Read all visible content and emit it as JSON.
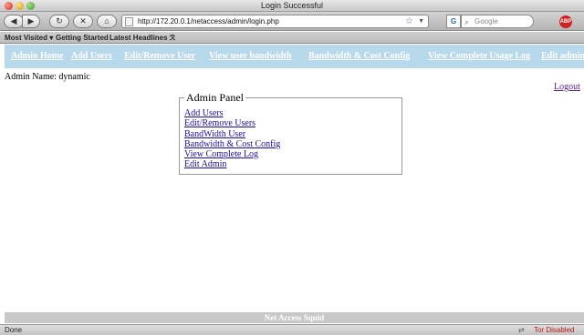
{
  "window": {
    "title": "Login Successful"
  },
  "toolbar": {
    "back_glyph": "◀",
    "forward_glyph": "▶",
    "reload_glyph": "↻",
    "stop_glyph": "✕",
    "home_glyph": "⌂",
    "url": "http://172.20.0.1/netaccess/admin/login.php",
    "search_placeholder": "Google",
    "search_engine_glyph": "G",
    "abp_label": "ABP"
  },
  "bookmarks": [
    {
      "label": "Most Visited ▾"
    },
    {
      "label": "Getting Started"
    },
    {
      "label": "Latest Headlines ℛ"
    }
  ],
  "page_nav": [
    {
      "label": "Admin Home"
    },
    {
      "label": "Add Users"
    },
    {
      "label": "Edit/Remove User"
    },
    {
      "label": "View user bandwidth"
    },
    {
      "label": "Bandwidth & Cost Config"
    },
    {
      "label": "View Complete Usage Log"
    },
    {
      "label": "Edit admin"
    }
  ],
  "admin": {
    "name_label": "Admin Name: dynamic",
    "logout_label": "Logout"
  },
  "panel": {
    "title": "Admin Panel",
    "links": [
      {
        "label": "Add Users"
      },
      {
        "label": "Edit/Remove Users"
      },
      {
        "label": "BandWidth User"
      },
      {
        "label": "Bandwidth & Cost Config"
      },
      {
        "label": "View Complete Log"
      },
      {
        "label": "Edit Admin"
      }
    ]
  },
  "footer": {
    "text": "Net Access Squid"
  },
  "status": {
    "text": "Done",
    "tor_label": "Tor Disabled"
  },
  "colors": {
    "nav_bg": "#b8d8ec",
    "footer_bg": "#c8c8c8",
    "tor_red": "#c01818"
  }
}
